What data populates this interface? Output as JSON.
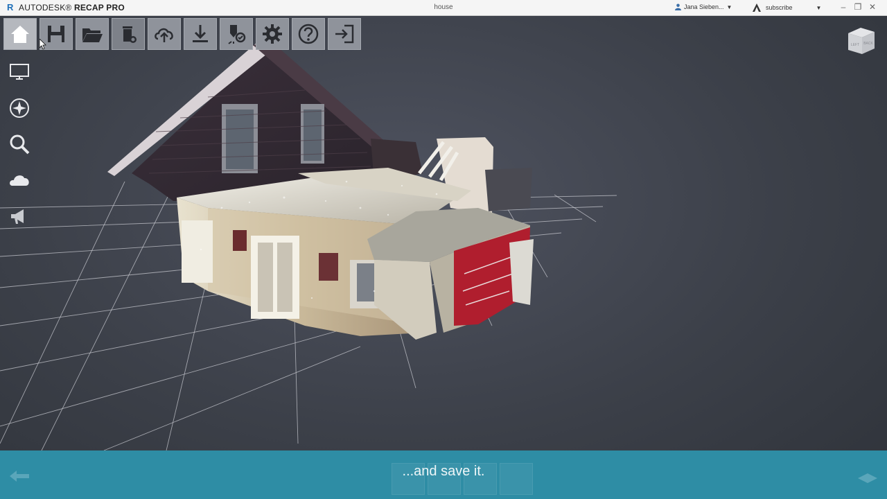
{
  "titlebar": {
    "app_prefix": "AUTODESK",
    "app_name": "RECAP PRO",
    "document": "house",
    "user": "Jana Sieben...",
    "subscribe": "subscribe"
  },
  "toolbar": {
    "buttons": [
      {
        "name": "home",
        "icon": "home-icon"
      },
      {
        "name": "save",
        "icon": "save-icon"
      },
      {
        "name": "open",
        "icon": "folder-icon"
      },
      {
        "name": "delete",
        "icon": "trash-icon"
      },
      {
        "name": "upload",
        "icon": "cloud-upload-icon"
      },
      {
        "name": "download",
        "icon": "download-icon"
      },
      {
        "name": "markup",
        "icon": "pin-tag-icon"
      },
      {
        "name": "settings",
        "icon": "gear-icon"
      },
      {
        "name": "help",
        "icon": "help-icon"
      },
      {
        "name": "exit",
        "icon": "exit-icon"
      }
    ]
  },
  "rail": {
    "items": [
      {
        "name": "display",
        "icon": "monitor-icon"
      },
      {
        "name": "navigation",
        "icon": "compass-icon"
      },
      {
        "name": "search",
        "icon": "search-icon"
      },
      {
        "name": "cloud",
        "icon": "cloud-icon"
      },
      {
        "name": "announce",
        "icon": "megaphone-icon"
      }
    ]
  },
  "viewcube": {
    "faces": [
      "LEFT",
      "BACK"
    ]
  },
  "bottombar": {
    "caption": "...and save it."
  },
  "colors": {
    "accent": "#2e8da5",
    "titlebar": "#f5f5f5",
    "toolbar_button": "#8f939b",
    "viewport": "#3c4049"
  }
}
